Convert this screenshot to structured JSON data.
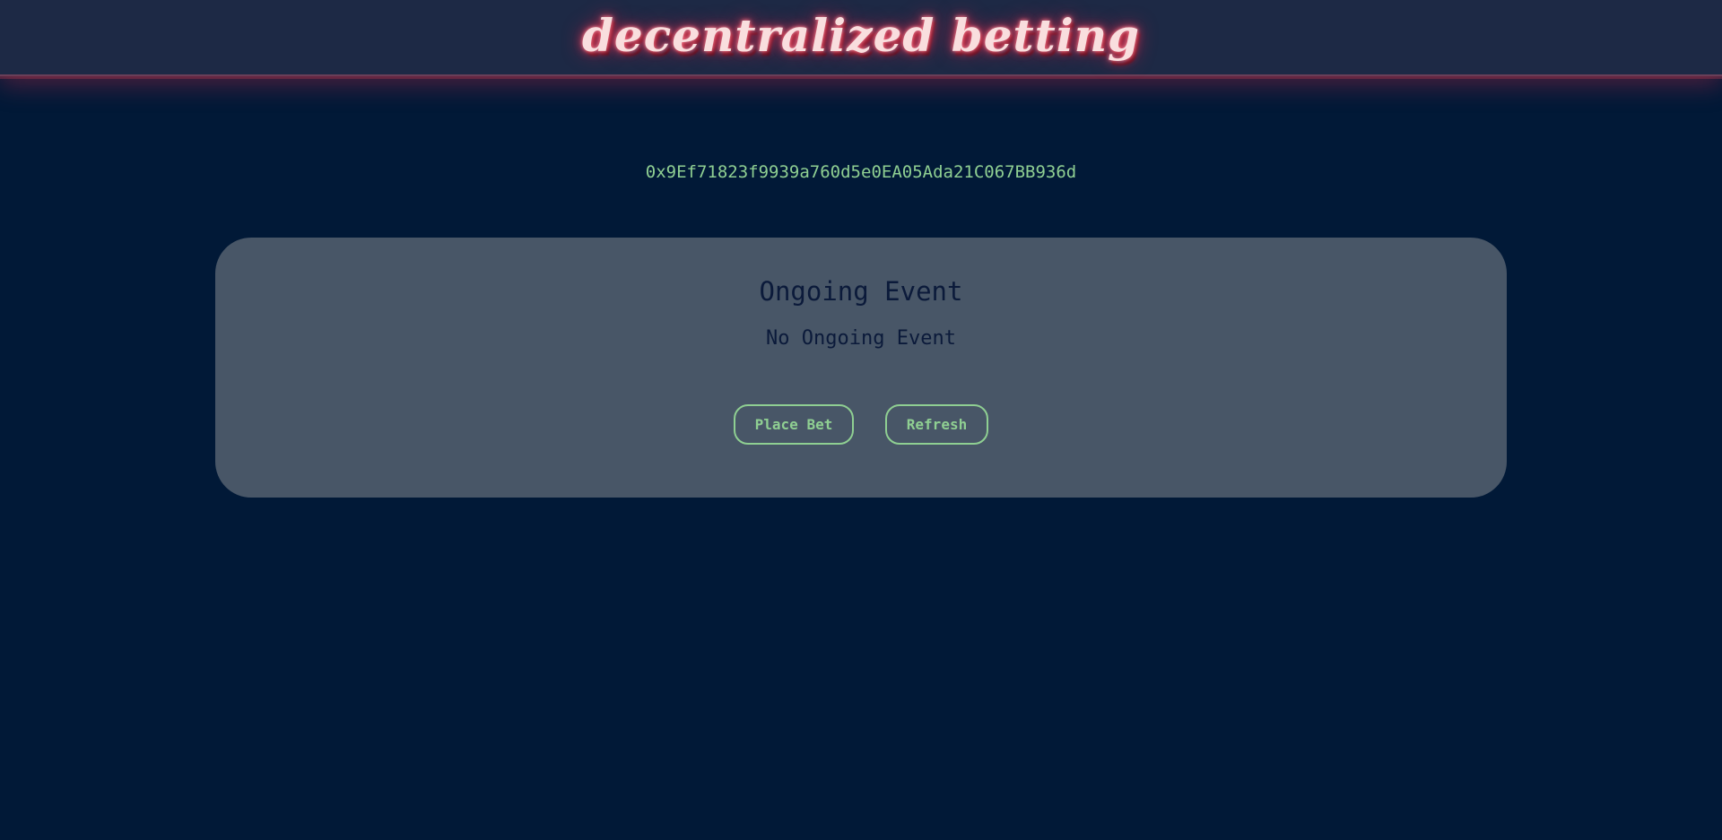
{
  "header": {
    "logo_text": "decentralized betting"
  },
  "account": {
    "address": "0x9Ef71823f9939a760d5e0EA05Ada21C067BB936d"
  },
  "event_card": {
    "title": "Ongoing Event",
    "status": "No Ongoing Event",
    "place_bet_label": "Place Bet",
    "refresh_label": "Refresh"
  },
  "colors": {
    "background": "#011937",
    "header": "#1d2945",
    "neon_glow": "#e8445e",
    "card": "#485667",
    "accent_green": "#8fcf92",
    "dark_text": "#0b1a3a"
  }
}
